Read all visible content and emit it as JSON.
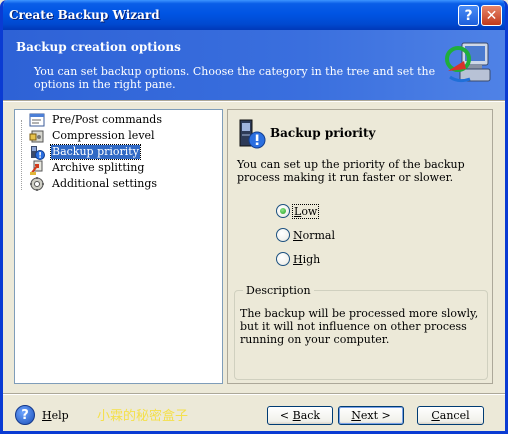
{
  "window": {
    "title": "Create Backup Wizard",
    "help_glyph": "?",
    "close_glyph": "✕"
  },
  "header": {
    "title": "Backup creation options",
    "description": "You can set backup options. Choose the category in the tree and set the options in the right pane.",
    "icon": "backup-options-icon"
  },
  "tree": {
    "items": [
      {
        "label": "Pre/Post commands",
        "icon": "commands-icon"
      },
      {
        "label": "Compression level",
        "icon": "compression-icon"
      },
      {
        "label": "Backup priority",
        "icon": "priority-icon",
        "selected": true
      },
      {
        "label": "Archive splitting",
        "icon": "splitting-icon"
      },
      {
        "label": "Additional settings",
        "icon": "settings-icon"
      }
    ]
  },
  "pane": {
    "title": "Backup priority",
    "description": "You can set up the priority of the backup process making it run faster or slower.",
    "options": [
      {
        "key": "L",
        "rest": "ow",
        "checked": true
      },
      {
        "key": "N",
        "rest": "ormal",
        "checked": false
      },
      {
        "key": "H",
        "rest": "igh",
        "checked": false
      }
    ],
    "group_label": "Description",
    "group_text": "The backup will be processed more slowly, but it will not influence on other process running on your computer."
  },
  "footer": {
    "help_glyph": "?",
    "help_key": "H",
    "help_rest": "elp",
    "watermark": "小霖的秘密盒子",
    "back_prefix": "< ",
    "back_key": "B",
    "back_rest": "ack",
    "next_key": "N",
    "next_rest": "ext >",
    "cancel_key": "C",
    "cancel_rest": "ancel"
  },
  "colors": {
    "title_bar": "#0054e3",
    "header_bg": "#3a6fde",
    "selection": "#316ac5",
    "dialog_bg": "#ece9d8"
  }
}
